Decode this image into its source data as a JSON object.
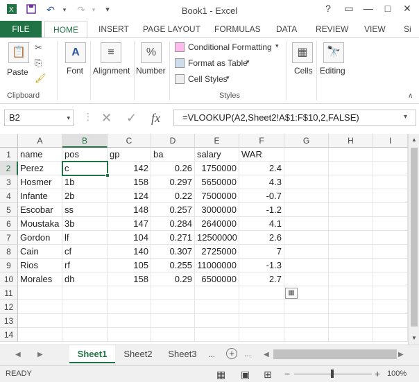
{
  "app": {
    "title": "Book1 - Excel",
    "accent": "#217346"
  },
  "window_controls": {
    "help": "?",
    "restore": "▭",
    "minimize": "—",
    "maximize": "□",
    "close": "✕"
  },
  "quick_access": {
    "undo": "↶",
    "redo": "↷"
  },
  "tabs": [
    "FILE",
    "HOME",
    "INSERT",
    "PAGE LAYOUT",
    "FORMULAS",
    "DATA",
    "REVIEW",
    "VIEW",
    "Si"
  ],
  "active_tab": "HOME",
  "ribbon": {
    "paste": "Paste",
    "font": "Font",
    "alignment": "Alignment",
    "number": "Number",
    "conditional_formatting": "Conditional Formatting",
    "format_as_table": "Format as Table",
    "cell_styles": "Cell Styles",
    "cells": "Cells",
    "editing": "Editing",
    "group_clipboard": "Clipboard",
    "group_styles": "Styles"
  },
  "formula_bar": {
    "name_box": "B2",
    "fx": "fx",
    "formula": "=VLOOKUP(A2,Sheet2!A$1:F$10,2,FALSE)"
  },
  "grid": {
    "columns": [
      "A",
      "B",
      "C",
      "D",
      "E",
      "F",
      "G",
      "H",
      "I"
    ],
    "rows": [
      [
        "name",
        "pos",
        "gp",
        "ba",
        "salary",
        "WAR"
      ],
      [
        "Perez",
        "c",
        "142",
        "0.26",
        "1750000",
        "2.4"
      ],
      [
        "Hosmer",
        "1b",
        "158",
        "0.297",
        "5650000",
        "4.3"
      ],
      [
        "Infante",
        "2b",
        "124",
        "0.22",
        "7500000",
        "-0.7"
      ],
      [
        "Escobar",
        "ss",
        "148",
        "0.257",
        "3000000",
        "-1.2"
      ],
      [
        "Moustaka",
        "3b",
        "147",
        "0.284",
        "2640000",
        "4.1"
      ],
      [
        "Gordon",
        "lf",
        "104",
        "0.271",
        "12500000",
        "2.6"
      ],
      [
        "Cain",
        "cf",
        "140",
        "0.307",
        "2725000",
        "7"
      ],
      [
        "Rios",
        "rf",
        "105",
        "0.255",
        "11000000",
        "-1.3"
      ],
      [
        "Morales",
        "dh",
        "158",
        "0.29",
        "6500000",
        "2.7"
      ]
    ],
    "row_numbers": [
      "1",
      "2",
      "3",
      "4",
      "5",
      "6",
      "7",
      "8",
      "9",
      "10",
      "11",
      "12",
      "13",
      "14"
    ]
  },
  "sheets": [
    "Sheet1",
    "Sheet2",
    "Sheet3"
  ],
  "active_sheet": "Sheet1",
  "sheet_more": "...",
  "status": {
    "ready": "READY",
    "zoom": "100%"
  }
}
